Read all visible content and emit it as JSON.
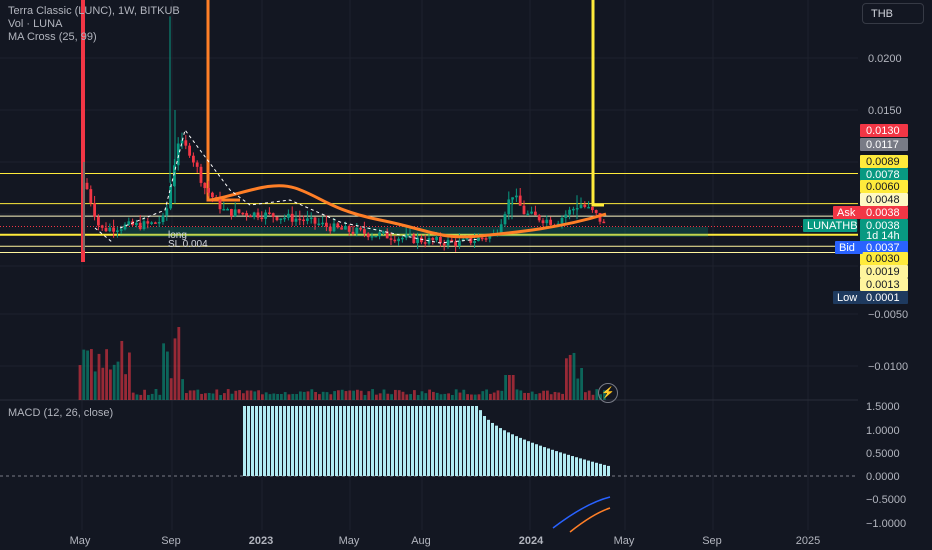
{
  "legend": {
    "symbol": "Terra Classic (LUNC), 1W, BITKUB",
    "vol": "Vol · LUNA",
    "ma": "MA Cross (25, 99)",
    "macd": "MACD (12, 26, close)"
  },
  "currency": "THB",
  "bolt_icon": "⚡",
  "price_axis": [
    "0.0200",
    "0.0150",
    "−0.0050",
    "−0.0100"
  ],
  "macd_axis": [
    "1.5000",
    "1.0000",
    "0.5000",
    "0.0000",
    "−0.5000",
    "−1.0000"
  ],
  "time_axis": [
    "May",
    "Sep",
    "2023",
    "May",
    "Aug",
    "2024",
    "May",
    "Sep",
    "2025"
  ],
  "price_badges": [
    {
      "text": "0.0130",
      "bg": "#f23645",
      "fg": "#ffffff"
    },
    {
      "text": "0.0117",
      "bg": "#787b86",
      "fg": "#ffffff"
    },
    {
      "text": "0.0089",
      "bg": "#ffeb3b",
      "fg": "#131722"
    },
    {
      "text": "0.0078",
      "bg": "#089981",
      "fg": "#ffffff"
    },
    {
      "text": "0.0060",
      "bg": "#ffeb3b",
      "fg": "#131722"
    },
    {
      "text": "0.0048",
      "bg": "#fff9c4",
      "fg": "#131722"
    },
    {
      "text": "0.0038",
      "bg": "#f23645",
      "fg": "#ffffff"
    },
    {
      "text": "0.0038",
      "bg": "#089981",
      "fg": "#ffffff"
    },
    {
      "text": "1d 14h",
      "bg": "#089981",
      "fg": "#ffffff"
    },
    {
      "text": "0.0037",
      "bg": "#2962ff",
      "fg": "#ffffff"
    },
    {
      "text": "0.0030",
      "bg": "#ffeb3b",
      "fg": "#131722"
    },
    {
      "text": "0.0019",
      "bg": "#fff59d",
      "fg": "#131722"
    },
    {
      "text": "0.0013",
      "bg": "#fff59d",
      "fg": "#131722"
    },
    {
      "text": "0.0001",
      "bg": "#1e3a5f",
      "fg": "#ffffff"
    }
  ],
  "tags": [
    {
      "text": "Ask",
      "bg": "#f23645"
    },
    {
      "text": "LUNATHB",
      "bg": "#089981"
    },
    {
      "text": "Bid",
      "bg": "#2962ff"
    },
    {
      "text": "Low",
      "bg": "#1e3a5f"
    }
  ],
  "annotations": {
    "long": "long",
    "sl": "SL 0.004"
  },
  "colors": {
    "background": "#131722",
    "up": "#089981",
    "down": "#f23645",
    "ma_fast": "#ff7f27",
    "ma_slow": "#ffeb3b",
    "macd_hist": "#b2ebf2"
  },
  "chart_data": [
    {
      "type": "candlestick",
      "title": "Terra Classic (LUNC), 1W, BITKUB",
      "currency": "THB",
      "ylim": [
        -0.012,
        0.024
      ],
      "y_ticks": [
        0.02,
        0.015,
        -0.005,
        -0.01
      ],
      "x_ticks": [
        "May",
        "Sep",
        "2023",
        "May",
        "Aug",
        "2024",
        "May",
        "Sep",
        "2025"
      ],
      "last_price": 0.0038,
      "ask": 0.0038,
      "bid": 0.0037,
      "low": 0.0001,
      "horizontal_levels": [
        0.0089,
        0.006,
        0.0048,
        0.003,
        0.0019,
        0.0013
      ],
      "series": [
        {
          "name": "MA Cross (25, 99)",
          "ma_fast": "orange",
          "ma_slow": "yellow"
        }
      ],
      "annotations": [
        "long",
        "SL 0.004"
      ]
    },
    {
      "type": "bar",
      "title": "MACD (12, 26, close)",
      "ylim": [
        -1.0,
        1.5
      ],
      "y_ticks": [
        1.5,
        1.0,
        0.5,
        0.0,
        -0.5,
        -1.0
      ],
      "histogram_start": 1.5,
      "histogram_end": 0.2
    }
  ]
}
